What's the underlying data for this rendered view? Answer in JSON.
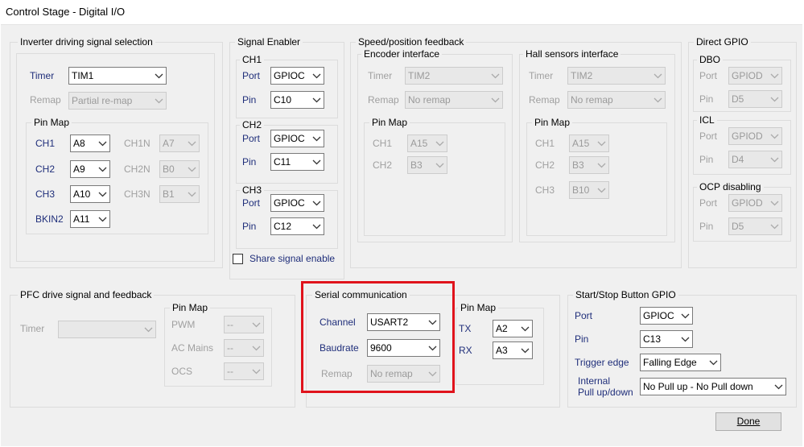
{
  "window": {
    "title": "Control Stage - Digital I/O"
  },
  "colors": {
    "enabled_label": "#1f2e7a",
    "disabled_label": "#a0a0a0",
    "highlight": "#e0131c",
    "panel_bg": "#f0f0f0"
  },
  "inverter": {
    "title": "Inverter driving signal selection",
    "timer_label": "Timer",
    "timer_value": "TIM1",
    "remap_label": "Remap",
    "remap_value": "Partial re-map",
    "pinmap_title": "Pin Map",
    "ch1": "CH1",
    "ch1_value": "A8",
    "ch2": "CH2",
    "ch2_value": "A9",
    "ch3": "CH3",
    "ch3_value": "A10",
    "bkin2": "BKIN2",
    "bkin2_value": "A11",
    "ch1n": "CH1N",
    "ch1n_value": "A7",
    "ch2n": "CH2N",
    "ch2n_value": "B0",
    "ch3n": "CH3N",
    "ch3n_value": "B1"
  },
  "enabler": {
    "title": "Signal Enabler",
    "ch1_title": "CH1",
    "ch2_title": "CH2",
    "ch3_title": "CH3",
    "port_label": "Port",
    "pin_label": "Pin",
    "ch1_port": "GPIOC",
    "ch1_pin": "C10",
    "ch2_port": "GPIOC",
    "ch2_pin": "C11",
    "ch3_port": "GPIOC",
    "ch3_pin": "C12",
    "share_label": "Share signal enable"
  },
  "feedback": {
    "title": "Speed/position feedback",
    "encoder_title": "Encoder interface",
    "hall_title": "Hall sensors interface",
    "timer_label": "Timer",
    "remap_label": "Remap",
    "pinmap_title": "Pin Map",
    "enc_timer": "TIM2",
    "enc_remap": "No remap",
    "enc_ch1_label": "CH1",
    "enc_ch1": "A15",
    "enc_ch2_label": "CH2",
    "enc_ch2": "B3",
    "hall_timer": "TIM2",
    "hall_remap": "No remap",
    "hall_ch1_label": "CH1",
    "hall_ch1": "A15",
    "hall_ch2_label": "CH2",
    "hall_ch2": "B3",
    "hall_ch3_label": "CH3",
    "hall_ch3": "B10"
  },
  "gpio": {
    "title": "Direct GPIO",
    "dbo_title": "DBO",
    "icl_title": "ICL",
    "ocp_title": "OCP disabling",
    "port_label": "Port",
    "pin_label": "Pin",
    "dbo_port": "GPIOD",
    "dbo_pin": "D5",
    "icl_port": "GPIOD",
    "icl_pin": "D4",
    "ocp_port": "GPIOD",
    "ocp_pin": "D5"
  },
  "pfc": {
    "title": "PFC drive signal and feedback",
    "timer_label": "Timer",
    "timer_value": "",
    "pinmap_title": "Pin Map",
    "pwm_label": "PWM",
    "pwm_value": "--",
    "acmains_label": "AC Mains",
    "acmains_value": "--",
    "ocs_label": "OCS",
    "ocs_value": "--"
  },
  "serial": {
    "title": "Serial communication",
    "channel_label": "Channel",
    "channel_value": "USART2",
    "baud_label": "Baudrate",
    "baud_value": "9600",
    "remap_label": "Remap",
    "remap_value": "No remap",
    "pinmap_title": "Pin Map",
    "tx_label": "TX",
    "tx_value": "A2",
    "rx_label": "RX",
    "rx_value": "A3"
  },
  "startstop": {
    "title": "Start/Stop Button GPIO",
    "port_label": "Port",
    "port_value": "GPIOC",
    "pin_label": "Pin",
    "pin_value": "C13",
    "trigger_label": "Trigger edge",
    "trigger_value": "Falling Edge",
    "pull_label_1": "Internal",
    "pull_label_2": "Pull up/down",
    "pull_value": "No Pull up - No Pull down"
  },
  "done_label": "Done"
}
